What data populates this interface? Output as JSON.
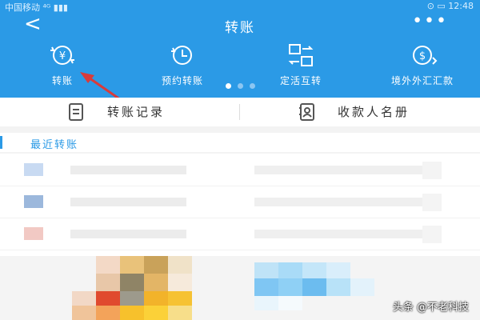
{
  "status_bar": {
    "carrier": "中国移动 ⁴ᴳ ▮▮▮",
    "right": "⊙ ▭ 12:48"
  },
  "nav": {
    "back_symbol": "<",
    "title": "转账",
    "more_symbol": "•••"
  },
  "quick_actions": [
    {
      "label": "转账",
      "icon": "transfer-yuan-icon"
    },
    {
      "label": "预约转账",
      "icon": "clock-icon"
    },
    {
      "label": "定活互转",
      "icon": "exchange-icon"
    },
    {
      "label": "境外外汇汇款",
      "icon": "dollar-coin-icon"
    }
  ],
  "actions": [
    {
      "label": "转账记录",
      "icon": "document-icon"
    },
    {
      "label": "收款人名册",
      "icon": "contact-book-icon"
    }
  ],
  "recent": {
    "title": "最近转账"
  },
  "credit": "头条 @不老科技",
  "colors": {
    "brand": "#2b9ae6",
    "annotation_arrow": "#d83b3b"
  }
}
